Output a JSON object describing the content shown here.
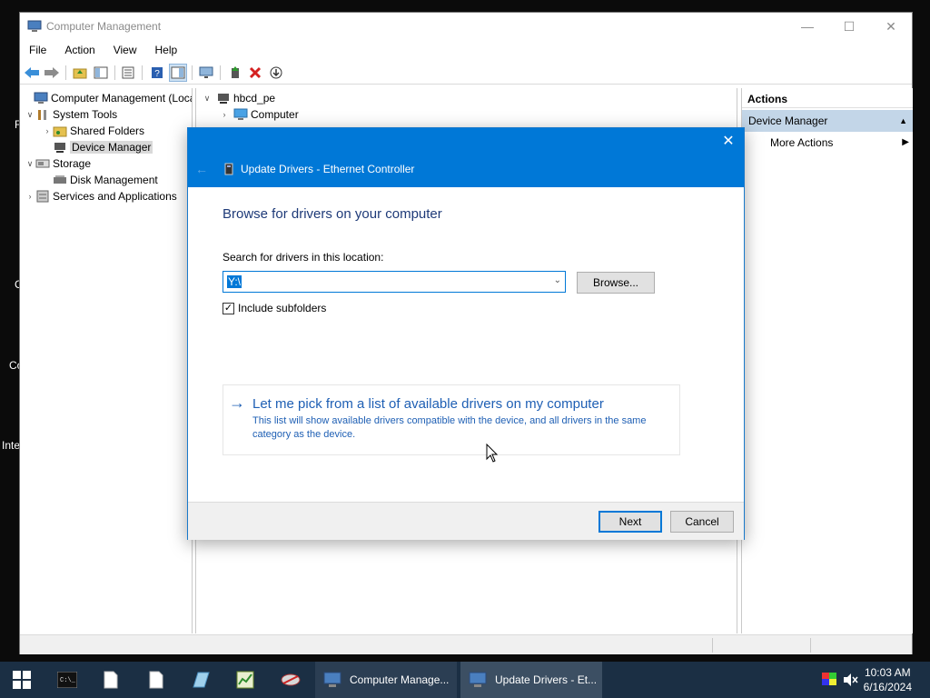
{
  "desktop": {
    "labels": [
      "F",
      "C",
      "Co",
      "Inte"
    ]
  },
  "cm_window": {
    "title": "Computer Management",
    "menu": [
      "File",
      "Action",
      "View",
      "Help"
    ],
    "tree": {
      "root": "Computer Management (Local",
      "system_tools": "System Tools",
      "shared_folders": "Shared Folders",
      "device_manager": "Device Manager",
      "storage": "Storage",
      "disk_management": "Disk Management",
      "services": "Services and Applications"
    },
    "center": {
      "host": "hbcd_pe",
      "computer": "Computer"
    },
    "actions": {
      "header": "Actions",
      "section": "Device Manager",
      "more": "More Actions"
    }
  },
  "dialog": {
    "title": "Update Drivers - Ethernet Controller",
    "heading": "Browse for drivers on your computer",
    "search_label": "Search for drivers in this location:",
    "path_value": "Y:\\",
    "browse_label": "Browse...",
    "include_subfolders": "Include subfolders",
    "pick_title": "Let me pick from a list of available drivers on my computer",
    "pick_desc": "This list will show available drivers compatible with the device, and all drivers in the same category as the device.",
    "next_label": "Next",
    "cancel_label": "Cancel"
  },
  "taskbar": {
    "tasks": [
      {
        "label": "Computer Manage..."
      },
      {
        "label": "Update Drivers - Et..."
      }
    ],
    "clock_time": "10:03 AM",
    "clock_date": "6/16/2024"
  },
  "colors": {
    "accent": "#0078d7",
    "taskbar": "#1b2f44",
    "link_blue": "#1e5fb4"
  }
}
